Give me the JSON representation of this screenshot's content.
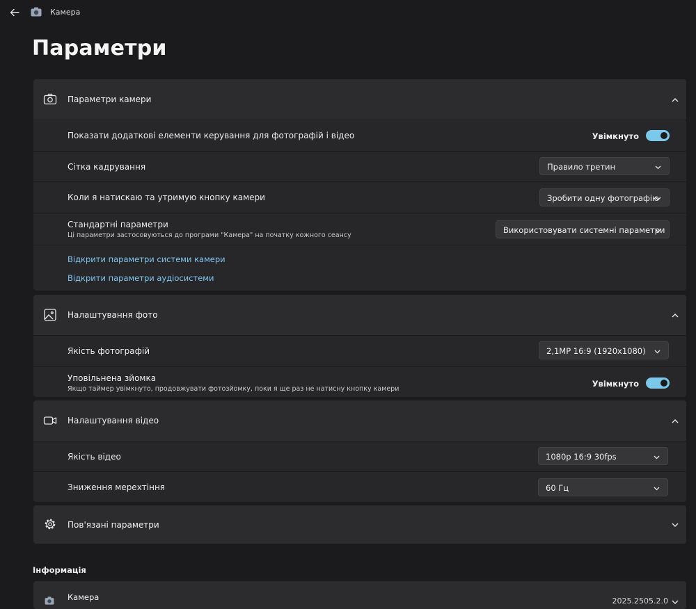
{
  "window": {
    "title": "Камера"
  },
  "page": {
    "title": "Параметри"
  },
  "camera_settings": {
    "title": "Параметри камери",
    "rows": [
      {
        "label": "Показати додаткові елементи керування для фотографій і відео",
        "toggle_text": "Увімкнуто",
        "toggle_on": true
      },
      {
        "label": "Сітка кадрування",
        "value": "Правило третин"
      },
      {
        "label": "Коли я натискаю та утримую кнопку камери",
        "value": "Зробити одну фотографію"
      },
      {
        "label": "Стандартні параметри",
        "description": "Ці параметри застосовуються до програми \"Камера\" на початку кожного сеансу",
        "value": "Використовувати системні параметри"
      }
    ],
    "links": [
      "Відкрити параметри системи камери",
      "Відкрити параметри аудіосистеми"
    ]
  },
  "photo_settings": {
    "title": "Налаштування фото",
    "rows": [
      {
        "label": "Якість фотографій",
        "value": "2,1MP 16:9 (1920x1080)"
      },
      {
        "label": "Уповільнена зйомка",
        "description": "Якщо таймер увімкнуто, продовжувати фотозйомку, поки я ще раз не натисну кнопку камери",
        "toggle_text": "Увімкнуто",
        "toggle_on": true
      }
    ]
  },
  "video_settings": {
    "title": "Налаштування відео",
    "rows": [
      {
        "label": "Якість відео",
        "value": "1080p 16:9 30fps"
      },
      {
        "label": "Зниження мерехтіння",
        "value": "60 Гц"
      }
    ]
  },
  "related_settings": {
    "title": "Пов'язані параметри"
  },
  "info": {
    "heading": "Інформація",
    "app_name": "Камера",
    "version": "2025.2505.2.0"
  },
  "colors": {
    "accent": "#7cc8ea",
    "link": "#7ec6ee",
    "background": "#1b1b1d",
    "card": "#272729"
  }
}
